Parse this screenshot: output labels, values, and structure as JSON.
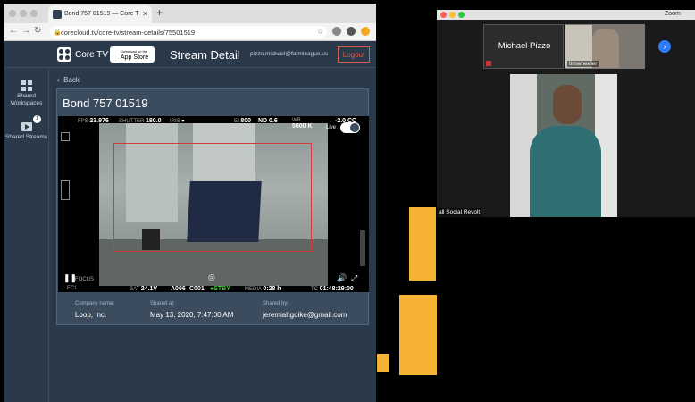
{
  "browser": {
    "tab_title": "Bond 757 01519 — Core T",
    "url": "corecloud.tv/core-tv/stream-details/75501519"
  },
  "header": {
    "brand": "Core TV",
    "app_store_small": "Download on the",
    "app_store": "App Store",
    "page_title": "Stream Detail",
    "user_email": "pizzo.michael@farmleague.us",
    "logout_label": "Logout"
  },
  "sidebar": {
    "items": [
      {
        "label": "Shared Workspaces",
        "icon": "workspaces-icon"
      },
      {
        "label": "Shared Streams",
        "icon": "streams-icon",
        "badge": "1"
      }
    ]
  },
  "main": {
    "back_label": "Back",
    "stream_title": "Bond 757 01519",
    "camera_hud": {
      "fps_label": "FPS",
      "fps": "23.976",
      "shutter_label": "SHUTTER",
      "shutter": "180.0",
      "iris_label": "IRIS",
      "ei_label": "EI",
      "ei": "800",
      "nd": "ND 0.6",
      "wb_label": "WB",
      "wb": "5600 K",
      "cc": "-2.0 CC",
      "live_label": "Live",
      "focus_label": "FOCUS",
      "ecl_label": "ECL",
      "bat_label": "BAT",
      "bat": "24.1V",
      "reel": "A006",
      "clip": "C001",
      "stby": "STBY",
      "media_label": "MEDIA",
      "media": "0:28 h",
      "tc_label": "TC",
      "tc": "01:48:29:00"
    },
    "info": {
      "company_label": "Company name:",
      "company": "Loop, Inc.",
      "shared_at_label": "Shared at:",
      "shared_at": "May 13, 2020, 7:47:00 AM",
      "shared_by_label": "Shared by:",
      "shared_by": "jeremiahgoike@gmail.com"
    }
  },
  "zoom": {
    "title": "Zoom",
    "participants": [
      {
        "name": "Michael Pizzo"
      },
      {
        "name": "timwheeler"
      }
    ],
    "active_speaker": "all Social Revolt"
  }
}
